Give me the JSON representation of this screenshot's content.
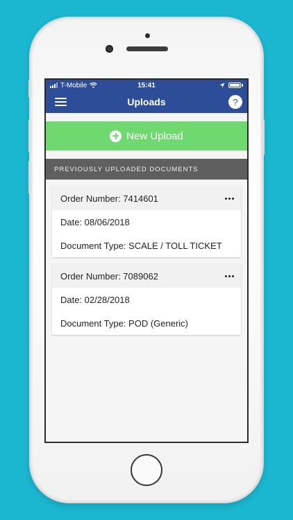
{
  "status_bar": {
    "carrier": "T-Mobile",
    "time": "15:41"
  },
  "nav": {
    "title": "Uploads",
    "help_glyph": "?"
  },
  "actions": {
    "new_upload_label": "New Upload"
  },
  "section": {
    "title": "PREVIOUSLY UPLOADED DOCUMENTS"
  },
  "documents": [
    {
      "order": "Order Number: 7414601",
      "date": "Date: 08/06/2018",
      "type": "Document Type: SCALE / TOLL TICKET"
    },
    {
      "order": "Order Number: 7089062",
      "date": "Date: 02/28/2018",
      "type": "Document Type: POD (Generic)"
    }
  ],
  "colors": {
    "background": "#1bb6cf",
    "nav": "#2e4d99",
    "new_upload": "#6fd96f",
    "section_header": "#5f5f5f"
  },
  "icons": [
    "menu-icon",
    "help-icon",
    "plus-circle-icon",
    "more-icon",
    "wifi-icon",
    "location-icon",
    "battery-icon"
  ]
}
